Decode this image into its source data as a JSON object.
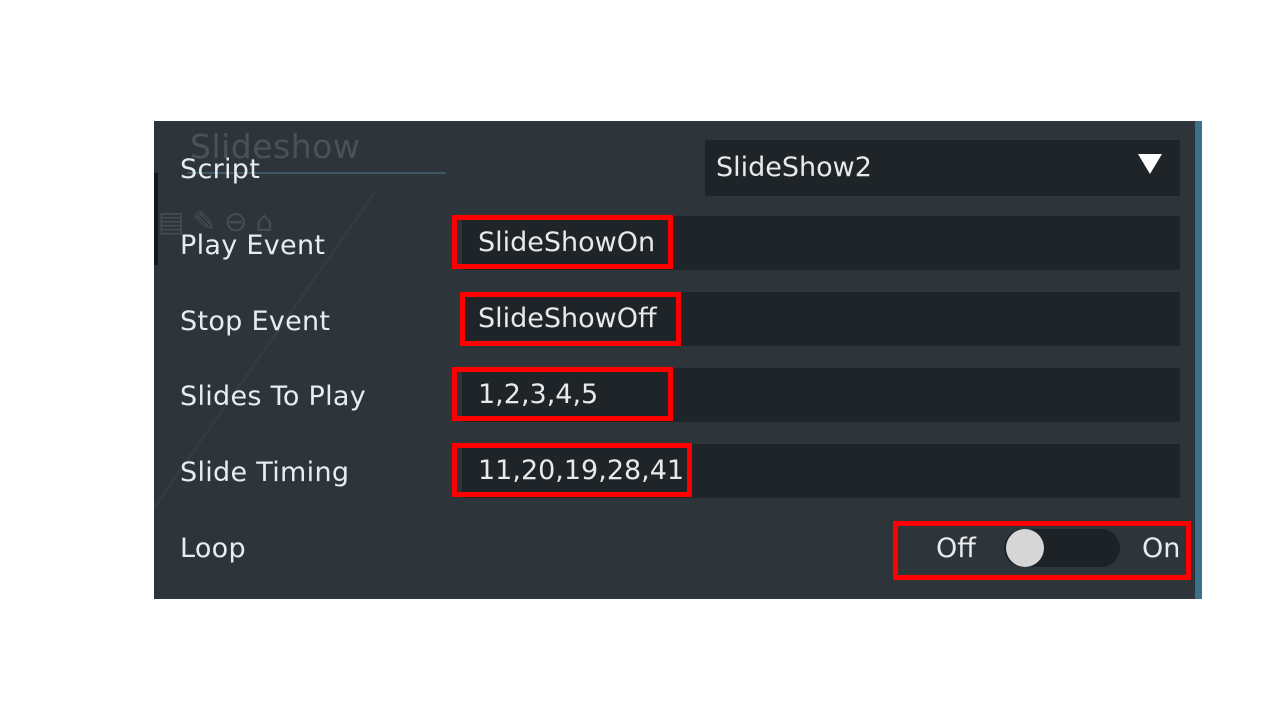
{
  "background": {
    "panel_title": "Slideshow"
  },
  "script_row": {
    "label": "Script",
    "selected_value": "SlideShow2",
    "arrow_icon": "triangle-down-icon"
  },
  "play_event": {
    "label": "Play Event",
    "value": "SlideShowOn"
  },
  "stop_event": {
    "label": "Stop Event",
    "value": "SlideShowOff"
  },
  "slides_to_play": {
    "label": "Slides To Play",
    "value": "1,2,3,4,5"
  },
  "slide_timing": {
    "label": "Slide Timing",
    "value": "11,20,19,28,41"
  },
  "loop": {
    "label": "Loop",
    "off_label": "Off",
    "on_label": "On",
    "state": "off"
  },
  "colors": {
    "panel_background": "#2e353a",
    "field_background": "#1e2428",
    "highlight": "#ff0000",
    "text": "#e8ecee"
  }
}
